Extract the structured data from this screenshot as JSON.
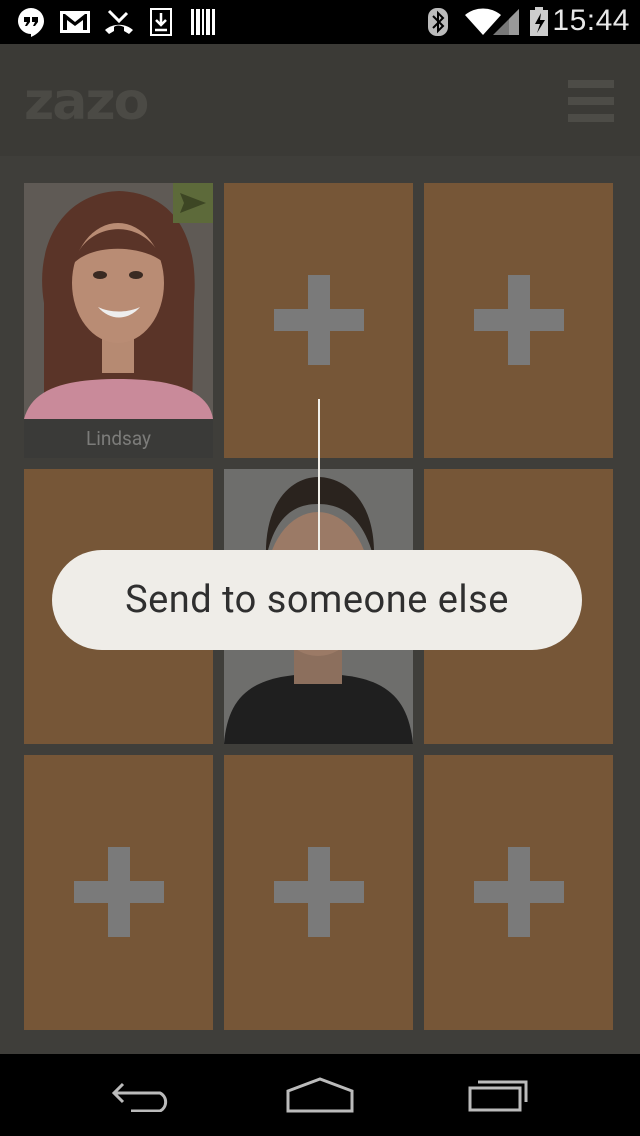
{
  "status_bar": {
    "time": "15:44",
    "icons": [
      "hangouts-icon",
      "gmail-icon",
      "missed-call-icon",
      "download-icon",
      "barcode-icon",
      "bluetooth-icon",
      "wifi-icon",
      "signal-icon",
      "battery-charging-icon"
    ]
  },
  "app_bar": {
    "logo": "zazo",
    "menu_icon": "hamburger-menu-icon"
  },
  "grid": {
    "tiles": [
      {
        "type": "contact",
        "name": "Lindsay",
        "badge": "send-icon"
      },
      {
        "type": "add",
        "icon": "plus-icon"
      },
      {
        "type": "add",
        "icon": "plus-icon"
      },
      {
        "type": "empty"
      },
      {
        "type": "contact-photo"
      },
      {
        "type": "empty"
      },
      {
        "type": "add",
        "icon": "plus-icon"
      },
      {
        "type": "add",
        "icon": "plus-icon"
      },
      {
        "type": "add",
        "icon": "plus-icon"
      }
    ]
  },
  "tooltip": {
    "text": "Send to someone else"
  },
  "nav_bar": {
    "buttons": [
      "back-icon",
      "home-icon",
      "recent-apps-icon"
    ]
  },
  "colors": {
    "tile": "#765637",
    "background": "#3f3e3a",
    "tooltip_bg": "#efede8",
    "plus": "#7a7a7a"
  }
}
